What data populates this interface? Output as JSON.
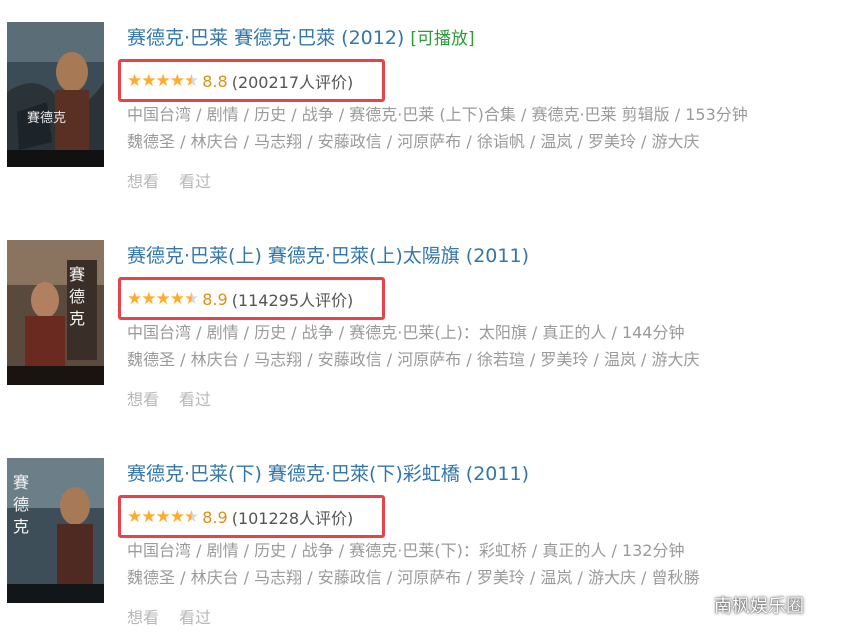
{
  "colors": {
    "title": "#3377aa",
    "playable": "#2a9d3a",
    "star": "#ffac2d",
    "score": "#e09015",
    "highlight_box": "#e8424a",
    "meta_text": "#9a9a9a"
  },
  "results": [
    {
      "title": "赛德克·巴莱 賽德克·巴萊 (2012)",
      "playable": "[可播放]",
      "stars": 4.5,
      "score": "8.8",
      "votes": "(200217人评价)",
      "meta_line1": "中国台湾 / 剧情 / 历史 / 战争 / 赛德克·巴莱 (上下)合集 / 赛德克·巴莱 剪辑版 / 153分钟",
      "meta_line2": "魏德圣 / 林庆台 / 马志翔 / 安藤政信 / 河原萨布 / 徐诣帆 / 温岚 / 罗美玲 / 游大庆",
      "want": "想看",
      "seen": "看过",
      "poster_icon": "movie-poster"
    },
    {
      "title": "赛德克·巴莱(上) 賽德克·巴萊(上)太陽旗 (2011)",
      "playable": "",
      "stars": 4.5,
      "score": "8.9",
      "votes": "(114295人评价)",
      "meta_line1": "中国台湾 / 剧情 / 历史 / 战争 / 赛德克·巴莱(上)：太阳旗 / 真正的人 / 144分钟",
      "meta_line2": "魏德圣 / 林庆台 / 马志翔 / 安藤政信 / 河原萨布 / 徐若瑄 / 罗美玲 / 温岚 / 游大庆",
      "want": "想看",
      "seen": "看过",
      "poster_icon": "movie-poster"
    },
    {
      "title": "赛德克·巴莱(下) 賽德克·巴萊(下)彩虹橋 (2011)",
      "playable": "",
      "stars": 4.5,
      "score": "8.9",
      "votes": "(101228人评价)",
      "meta_line1": "中国台湾 / 剧情 / 历史 / 战争 / 赛德克·巴莱(下)：彩虹桥 / 真正的人 / 132分钟",
      "meta_line2": "魏德圣 / 林庆台 / 马志翔 / 安藤政信 / 河原萨布 / 罗美玲 / 温岚 / 游大庆 / 曾秋勝",
      "want": "想看",
      "seen": "看过",
      "poster_icon": "movie-poster"
    }
  ],
  "watermark": "南枫娱乐圈"
}
